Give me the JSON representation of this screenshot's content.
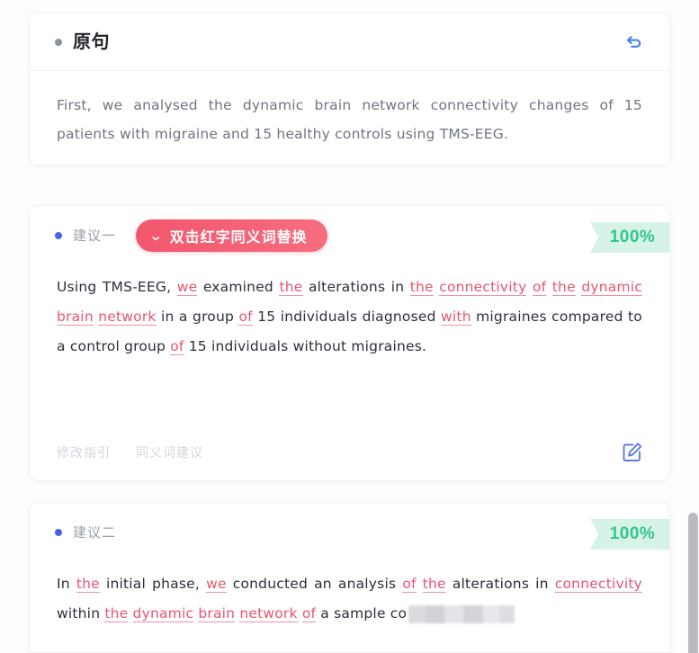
{
  "original": {
    "bullet_icon": "gray-dot-icon",
    "title": "原句",
    "undo_icon": "undo-arrow-icon",
    "text": "First, we analysed the dynamic brain network connectivity changes of 15 patients with migraine and 15 healthy controls using TMS-EEG."
  },
  "suggestions": [
    {
      "bullet_icon": "blue-dot-icon",
      "label": "建议一",
      "hint_pill": {
        "icon": "double-chevron-down-icon",
        "text": "双击红字同义词替换"
      },
      "score": "100%",
      "segments": [
        {
          "text": "Using TMS-EEG, ",
          "highlight": false
        },
        {
          "text": "we",
          "highlight": true
        },
        {
          "text": " examined ",
          "highlight": false
        },
        {
          "text": "the",
          "highlight": true
        },
        {
          "text": " alterations in ",
          "highlight": false
        },
        {
          "text": "the",
          "highlight": true
        },
        {
          "text": " ",
          "highlight": false
        },
        {
          "text": "connectivity",
          "highlight": true
        },
        {
          "text": " ",
          "highlight": false
        },
        {
          "text": "of",
          "highlight": true
        },
        {
          "text": " ",
          "highlight": false
        },
        {
          "text": "the",
          "highlight": true
        },
        {
          "text": " ",
          "highlight": false
        },
        {
          "text": "dynamic",
          "highlight": true
        },
        {
          "text": " ",
          "highlight": false
        },
        {
          "text": "brain",
          "highlight": true
        },
        {
          "text": " ",
          "highlight": false
        },
        {
          "text": "network",
          "highlight": true
        },
        {
          "text": " in a group ",
          "highlight": false
        },
        {
          "text": "of",
          "highlight": true
        },
        {
          "text": " 15 individuals diagnosed ",
          "highlight": false
        },
        {
          "text": "with",
          "highlight": true
        },
        {
          "text": " migraines compared to a control group ",
          "highlight": false
        },
        {
          "text": "of",
          "highlight": true
        },
        {
          "text": " 15 individuals without migraines.",
          "highlight": false
        }
      ],
      "footer_links": [
        "修改指引",
        "同义词建议"
      ],
      "edit_icon": "edit-square-pencil-icon"
    },
    {
      "bullet_icon": "blue-dot-icon",
      "label": "建议二",
      "score": "100%",
      "segments": [
        {
          "text": "In ",
          "highlight": false
        },
        {
          "text": "the",
          "highlight": true
        },
        {
          "text": " initial phase, ",
          "highlight": false
        },
        {
          "text": "we",
          "highlight": true
        },
        {
          "text": " conducted an analysis ",
          "highlight": false
        },
        {
          "text": "of",
          "highlight": true
        },
        {
          "text": " ",
          "highlight": false
        },
        {
          "text": "the",
          "highlight": true
        },
        {
          "text": " alterations in ",
          "highlight": false
        },
        {
          "text": "connectivity",
          "highlight": true
        },
        {
          "text": " within ",
          "highlight": false
        },
        {
          "text": "the",
          "highlight": true
        },
        {
          "text": " ",
          "highlight": false
        },
        {
          "text": "dynamic",
          "highlight": true
        },
        {
          "text": " ",
          "highlight": false
        },
        {
          "text": "brain",
          "highlight": true
        },
        {
          "text": " ",
          "highlight": false
        },
        {
          "text": "network",
          "highlight": true
        },
        {
          "text": " ",
          "highlight": false
        },
        {
          "text": "of",
          "highlight": true
        },
        {
          "text": " a sample co",
          "highlight": false
        },
        {
          "text": "",
          "highlight": false,
          "redacted": true
        }
      ]
    }
  ],
  "colors": {
    "accent_pink": "#f2566d",
    "highlight_text": "#e8566e",
    "score_green_text": "#32c68c",
    "score_green_bg": "#d7f3e7",
    "bullet_blue": "#4962e8",
    "icon_blue": "#4a7bf0",
    "body_text": "#2b2f38",
    "muted_text": "#9aa0ac"
  }
}
